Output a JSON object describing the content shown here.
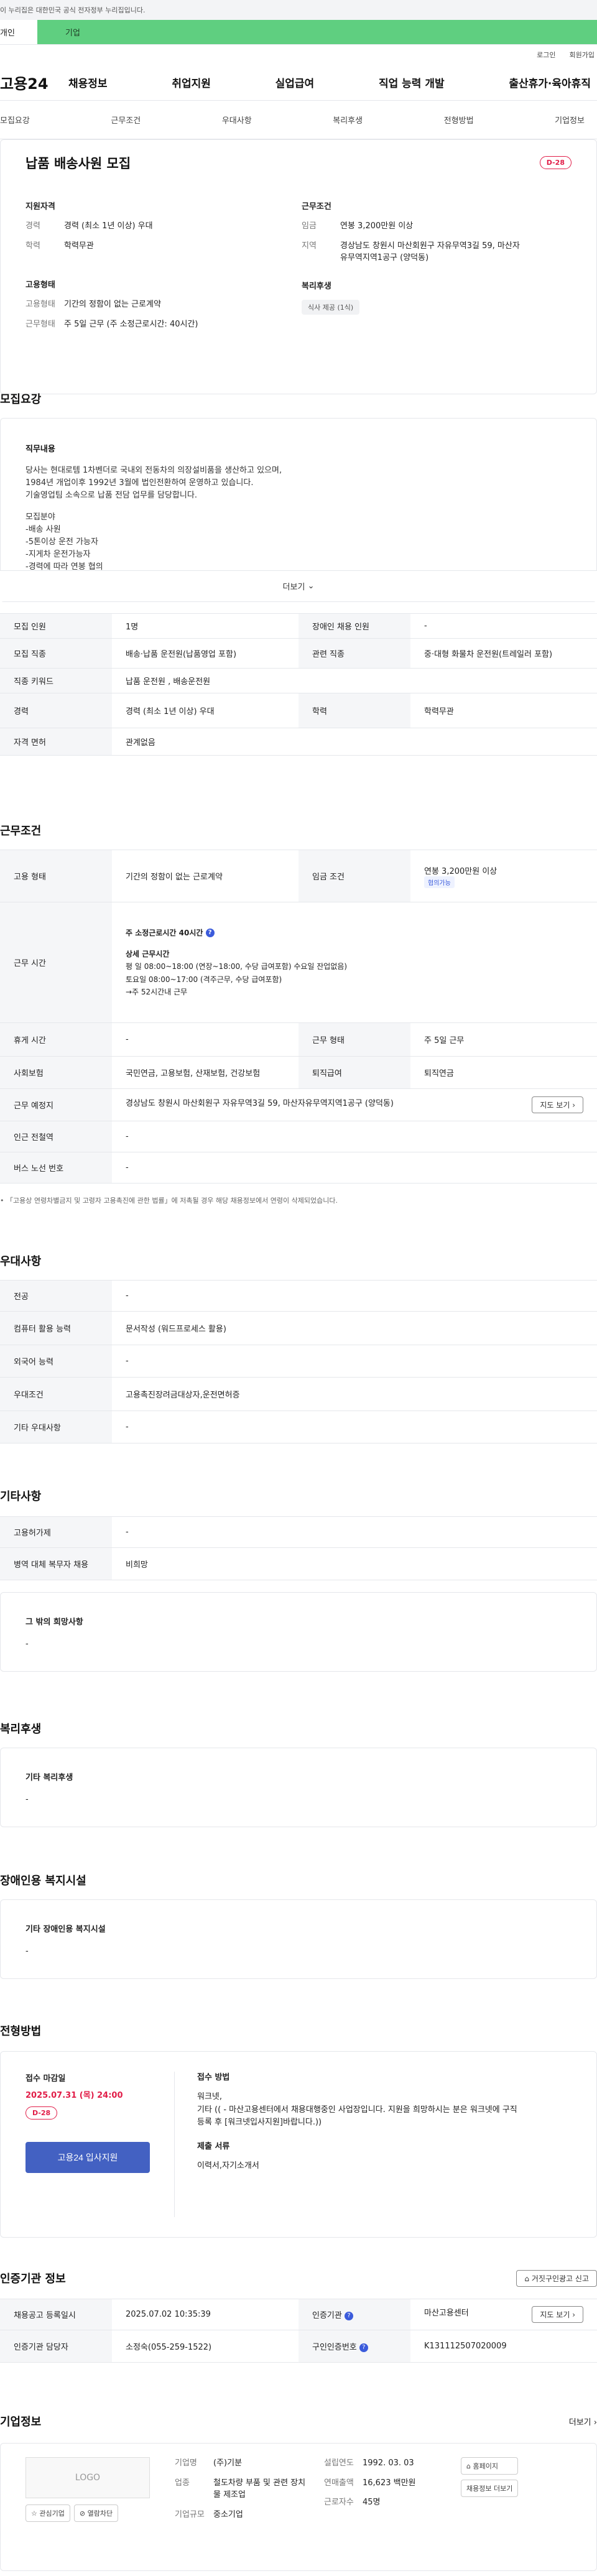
{
  "gov_banner": "이 누리집은 대한민국 공식 전자정부 누리집입니다.",
  "top_tabs": [
    "개인",
    "기업"
  ],
  "util": [
    "로그인",
    "회원가입"
  ],
  "logo": "고용24",
  "gnb": [
    "채용정보",
    "취업지원",
    "실업급여",
    "직업 능력 개발",
    "출산휴가·육아휴직"
  ],
  "subnav": [
    "모집요강",
    "근무조건",
    "우대사항",
    "복리후생",
    "전형방법",
    "기업정보"
  ],
  "summary": {
    "title": "납품 배송사원 모집",
    "dday": "D-28",
    "qual_title": "지원자격",
    "career_k": "경력",
    "career_v": "경력 (최소 1년 이상) 우대",
    "edu_k": "학력",
    "edu_v": "학력무관",
    "cond_title": "근무조건",
    "wage_k": "임금",
    "wage_v": "연봉 3,200만원 이상",
    "loc_k": "지역",
    "loc_v": "경상남도 창원시 마산회원구 자유무역3길 59, 마산자유무역지역1공구 (양덕동)",
    "emp_title": "고용형태",
    "type_k": "고용형태",
    "type_v": "기간의 정함이 없는 근로계약",
    "shape_k": "근무형태",
    "shape_v": "주 5일 근무 (주 소정근로시간: 40시간)",
    "welfare_title": "복리후생",
    "welfare_chip": "식사 제공 (1식)"
  },
  "recruit": {
    "title": "모집요강",
    "desc_heading": "직무내용",
    "desc_lines": [
      "당사는 현대로템 1차벤더로 국내외 전동차의 의장설비품을 생산하고 있으며,",
      "1984년 개업이후 1992년 3월에 법인전환하여 운영하고 있습니다.",
      "기술영업팀 소속으로 납품 전담 업무를 담당합니다.",
      "",
      "모집분야",
      "-배송 사원",
      "-5톤이상 운전 가능자",
      "-지게차 운전가능자",
      "-경력에 따라 연봉 협의"
    ],
    "more": "더보기",
    "rows": [
      [
        "모집 인원",
        "1명",
        "장애인 채용 인원",
        "-"
      ],
      [
        "모집 직종",
        "배송·납품 운전원(납품영업 포함)",
        "관련 직종",
        "중·대형 화물차 운전원(트레일러 포함)"
      ],
      [
        "직종 키워드",
        "납품 운전원 , 배송운전원",
        "",
        ""
      ],
      [
        "경력",
        "경력 (최소 1년 이상) 우대",
        "학력",
        "학력무관"
      ],
      [
        "자격 면허",
        "관계없음",
        "",
        ""
      ]
    ]
  },
  "work": {
    "title": "근무조건",
    "emp_type_k": "고용 형태",
    "emp_type_v": "기간의 정함이 없는 근로계약",
    "wage_k": "임금 조건",
    "wage_v": "연봉 3,200만원 이상",
    "wage_badge": "협의가능",
    "time_k": "근무 시간",
    "time_lines": [
      "주 소정근로시간 40시간",
      "",
      "상세 근무시간",
      "평   일 08:00~18:00 (연장~18:00, 수당 급여포함) 수요일 잔업없음)",
      "토요일 08:00~17:00 (격주근무, 수당 급여포함)",
      "→주 52시간내 근무"
    ],
    "rest_k": "휴게 시간",
    "rest_v": "-",
    "form_k": "근무 형태",
    "form_v": "주 5일 근무",
    "ins_k": "사회보험",
    "ins_v": "국민연금, 고용보험, 산재보험, 건강보험",
    "ret_k": "퇴직급여",
    "ret_v": "퇴직연금",
    "place_k": "근무 예정지",
    "place_v": "경상남도 창원시 마산회원구 자유무역3길 59, 마산자유무역지역1공구 (양덕동)",
    "map_btn": "지도 보기",
    "sub_k": "인근 전철역",
    "sub_v": "-",
    "bus_k": "버스 노선 번호",
    "bus_v": "-",
    "note": "「고용상 연령차별금지 및 고령자 고용촉진에 관한 법률」에 저촉될 경우 해당 채용정보에서 연령이 삭제되었습니다."
  },
  "pref": {
    "title": "우대사항",
    "rows": [
      [
        "전공",
        "-"
      ],
      [
        "컴퓨터 활용 능력",
        "문서작성 (워드프로세스 활용)"
      ],
      [
        "외국어 능력",
        "-"
      ],
      [
        "우대조건",
        "고용촉진장려금대상자,운전면허증"
      ],
      [
        "기타 우대사항",
        "-"
      ]
    ]
  },
  "etc": {
    "title": "기타사항",
    "rows": [
      [
        "고용허가제",
        "-"
      ],
      [
        "병역 대체 복무자 채용",
        "비희망"
      ]
    ],
    "box_title": "그 밖의 희망사항",
    "box_value": "-"
  },
  "welfare": {
    "title": "복리후생",
    "box_title": "기타 복리후생",
    "box_value": "-"
  },
  "disabled": {
    "title": "장애인용 복지시설",
    "box_title": "기타 장애인용 복지시설",
    "box_value": "-"
  },
  "process": {
    "title": "전형방법",
    "deadline_label": "접수 마감일",
    "deadline": "2025.07.31 (목) 24:00",
    "dday": "D-28",
    "apply": "고용24 입사지원",
    "method_label": "접수 방법",
    "method_lines": [
      "워크넷,",
      "기타 (( - 마산고용센터에서 채용대행중인 사업장입니다. 지원을 희망하시는 분은 워크넷에 구직",
      "등록 후 [워크넷입사지원]바랍니다.))"
    ],
    "docs_label": "제출 서류",
    "docs": "이력서,자기소개서"
  },
  "cert": {
    "title": "인증기관 정보",
    "report_btn": "거짓구인광고 신고",
    "reg_k": "채용공고 등록일시",
    "reg_v": "2025.07.02 10:35:39",
    "org_k": "인증기관",
    "org_v": "마산고용센터",
    "map_btn": "지도 보기",
    "mgr_k": "인증기관 담당자",
    "mgr_v": "소정숙(055-259-1522)",
    "num_k": "구인인증번호",
    "num_v": "K131112507020009"
  },
  "company": {
    "title": "기업정보",
    "more": "더보기",
    "logo": "LOGO",
    "fav": "관심기업",
    "block": "열람차단",
    "name_k": "기업명",
    "name_v": "(주)기분",
    "ind_k": "업종",
    "ind_v": "철도차량 부품 및 관련 장치물 제조업",
    "size_k": "기업규모",
    "size_v": "중소기업",
    "year_k": "설립연도",
    "year_v": "1992. 03. 03",
    "sales_k": "연매출액",
    "sales_v": "16,623 백만원",
    "emp_k": "근로자수",
    "emp_v": "45명",
    "home_btn": "홈페이지",
    "jobs_btn": "채용정보 더보기"
  }
}
